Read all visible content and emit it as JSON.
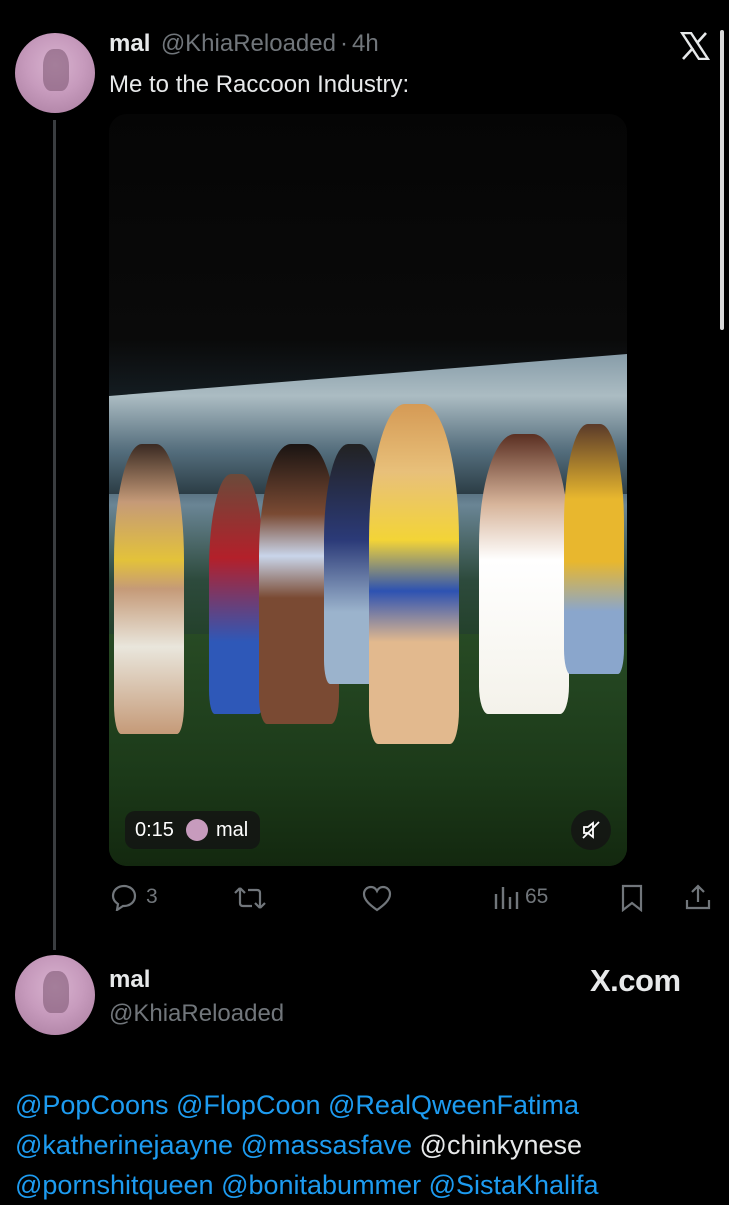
{
  "tweet": {
    "author_name": "mal",
    "author_handle": "@KhiaReloaded",
    "separator": "·",
    "time": "4h",
    "text": "Me to the Raccoon Industry:",
    "video": {
      "duration": "0:15",
      "owner_name": "mal"
    },
    "actions": {
      "replies": "3",
      "views": "65"
    },
    "icons": [
      "x-logo-icon",
      "reply-icon",
      "retweet-icon",
      "like-icon",
      "views-icon",
      "bookmark-icon",
      "share-icon",
      "mute-icon"
    ]
  },
  "card": {
    "author_name": "mal",
    "author_handle": "@KhiaReloaded",
    "brand": "X.com"
  },
  "mentions": {
    "line1": [
      "@PopCoons",
      "@FlopCoon",
      "@RealQweenFatima"
    ],
    "line2": [
      "@katherinejaayne",
      "@massasfave",
      "@chinkynese"
    ],
    "line3": [
      "@pornshitqueen",
      "@bonitabummer",
      "@SistaKhalifa"
    ]
  },
  "colors": {
    "link": "#1d9bf0",
    "muted": "#71767b",
    "text": "#e7e9ea",
    "background": "#000000"
  }
}
